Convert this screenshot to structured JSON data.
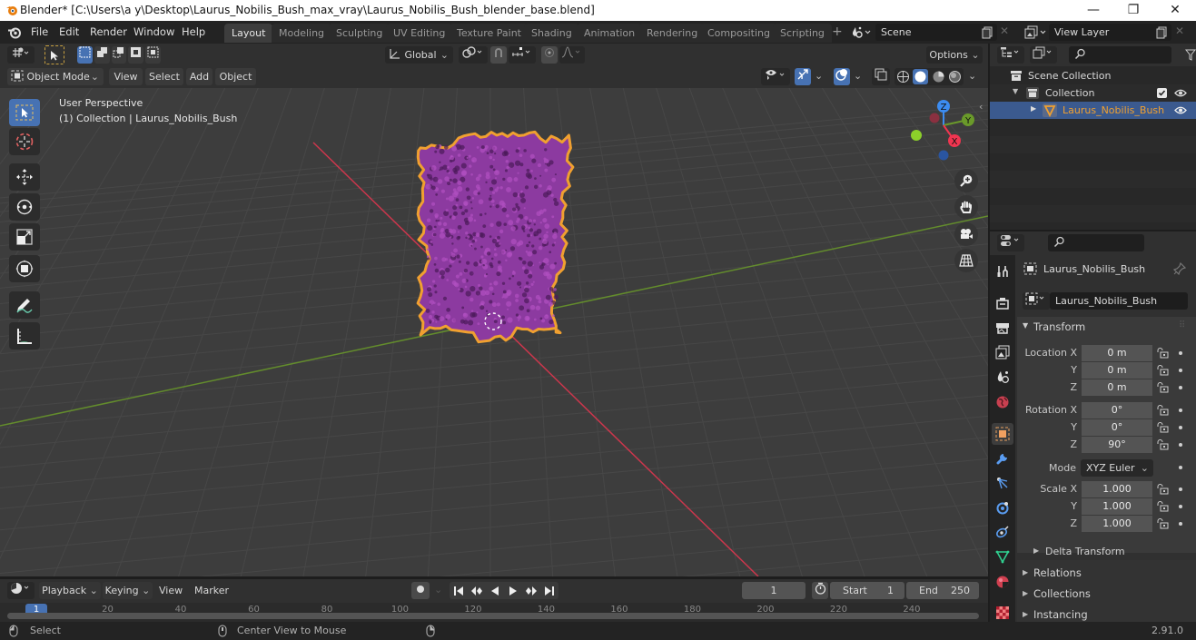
{
  "window": {
    "title": "Blender* [C:\\Users\\a y\\Desktop\\Laurus_Nobilis_Bush_max_vray\\Laurus_Nobilis_Bush_blender_base.blend]",
    "controls": {
      "minimize": "—",
      "maximize": "❐",
      "close": "✕"
    }
  },
  "menu": [
    "File",
    "Edit",
    "Render",
    "Window",
    "Help"
  ],
  "workspaces": [
    "Layout",
    "Modeling",
    "Sculpting",
    "UV Editing",
    "Texture Paint",
    "Shading",
    "Animation",
    "Rendering",
    "Compositing",
    "Scripting"
  ],
  "active_workspace": "Layout",
  "add_workspace": "+",
  "scene": {
    "name": "Scene"
  },
  "view_layer": {
    "name": "View Layer"
  },
  "viewport_header": {
    "transform_orientation": "Global",
    "options_label": "Options",
    "mode": "Object Mode",
    "menus": [
      "View",
      "Select",
      "Add",
      "Object"
    ]
  },
  "viewport": {
    "view_name": "User Perspective",
    "context": "(1) Collection | Laurus_Nobilis_Bush",
    "gizmo": {
      "x": "X",
      "y": "Y",
      "z": "Z"
    },
    "colors": {
      "x": "#f03550",
      "y": "#6a9a2a",
      "z": "#3c8cf0",
      "selection": "#f0a030",
      "object": "#8c3aa0"
    }
  },
  "outliner": {
    "search_placeholder": "",
    "items": [
      {
        "label": "Scene Collection",
        "level": 0
      },
      {
        "label": "Collection",
        "level": 1,
        "checked": true
      },
      {
        "label": "Laurus_Nobilis_Bush",
        "level": 2,
        "selected": true
      }
    ]
  },
  "properties": {
    "object_name": "Laurus_Nobilis_Bush",
    "datablock_name": "Laurus_Nobilis_Bush",
    "transform_label": "Transform",
    "location": {
      "label": "Location X",
      "x": "0 m",
      "y": "0 m",
      "z": "0 m"
    },
    "rotation": {
      "label": "Rotation X",
      "x": "0°",
      "y": "0°",
      "z": "90°"
    },
    "mode": {
      "label": "Mode",
      "value": "XYZ Euler"
    },
    "scale": {
      "label": "Scale X",
      "x": "1.000",
      "y": "1.000",
      "z": "1.000"
    },
    "axis_labels": {
      "y": "Y",
      "z": "Z"
    },
    "subsections": [
      "Delta Transform"
    ],
    "sections": [
      "Relations",
      "Collections",
      "Instancing"
    ]
  },
  "timeline": {
    "menus": [
      "Playback",
      "Keying",
      "View",
      "Marker"
    ],
    "current_frame": "1",
    "start_label": "Start",
    "start": "1",
    "end_label": "End",
    "end": "250",
    "ruler": [
      "1",
      "20",
      "40",
      "60",
      "80",
      "100",
      "120",
      "140",
      "160",
      "180",
      "200",
      "220",
      "240"
    ]
  },
  "statusbar": {
    "left_action": "Select",
    "middle_action": "Center View to Mouse",
    "version": "2.91.0"
  }
}
